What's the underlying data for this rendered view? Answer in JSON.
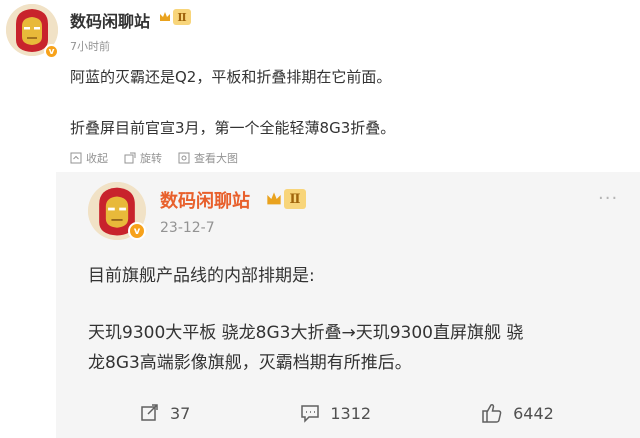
{
  "original_post": {
    "author": "数码闲聊站",
    "level": "Ⅱ",
    "verified_mark": "v",
    "time": "7小时前",
    "lines": [
      "阿蓝的灭霸还是Q2，平板和折叠排期在它前面。",
      "折叠屏目前官宣3月，第一个全能轻薄8G3折叠。"
    ],
    "actions": {
      "collect": "收起",
      "repost": "旋转",
      "zoom": "查看大图"
    }
  },
  "repost": {
    "author": "数码闲聊站",
    "level": "Ⅱ",
    "verified_mark": "v",
    "date": "23-12-7",
    "more": "···",
    "lines": [
      "目前旗舰产品线的内部排期是:",
      "天玑9300大平板 骁龙8G3大折叠→天玑9300直屏旗舰 骁",
      "龙8G3高端影像旗舰，灭霸档期有所推后。"
    ],
    "stats": {
      "reposts": "37",
      "comments": "1312",
      "likes": "6442"
    }
  },
  "colors": {
    "text": "#333333",
    "muted": "#939393",
    "badge_orange": "#f7a21b",
    "repost_bg": "#f5f5f5"
  },
  "icons": {
    "avatar": "iron-man-avatar",
    "collect": "collapse-icon",
    "repost": "rotate-icon",
    "zoom": "zoom-icon",
    "repost_count": "repost-icon",
    "comment_count": "comment-icon",
    "like_count": "like-icon"
  }
}
